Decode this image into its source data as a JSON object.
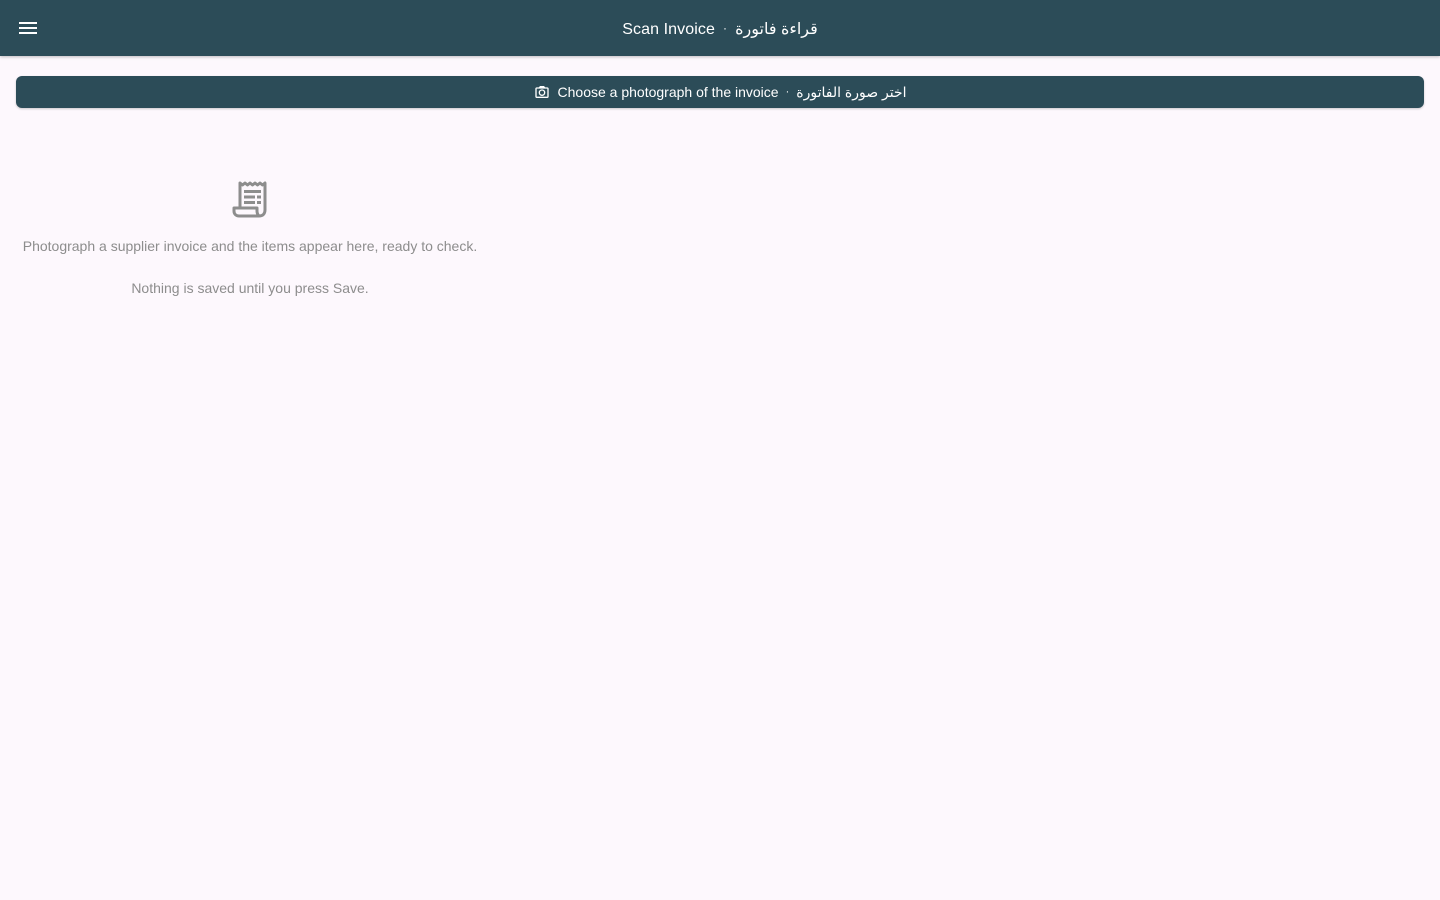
{
  "app_bar": {
    "menu_icon": "menu-icon",
    "title_en": "Scan Invoice",
    "title_separator": "·",
    "title_ar": "قراءة فاتورة"
  },
  "choose_button": {
    "icon": "camera-icon",
    "label_en": "Choose a photograph of the invoice",
    "separator": "·",
    "label_ar": "اختر صورة الفاتورة"
  },
  "empty_state": {
    "icon": "receipt-icon",
    "message": "Photograph a supplier invoice and the items appear here, ready to check.",
    "note": "Nothing is saved until you press Save."
  },
  "colors": {
    "primary": "#2c4c58",
    "background": "#fdf8fd",
    "muted_text": "#8d8d8d"
  }
}
